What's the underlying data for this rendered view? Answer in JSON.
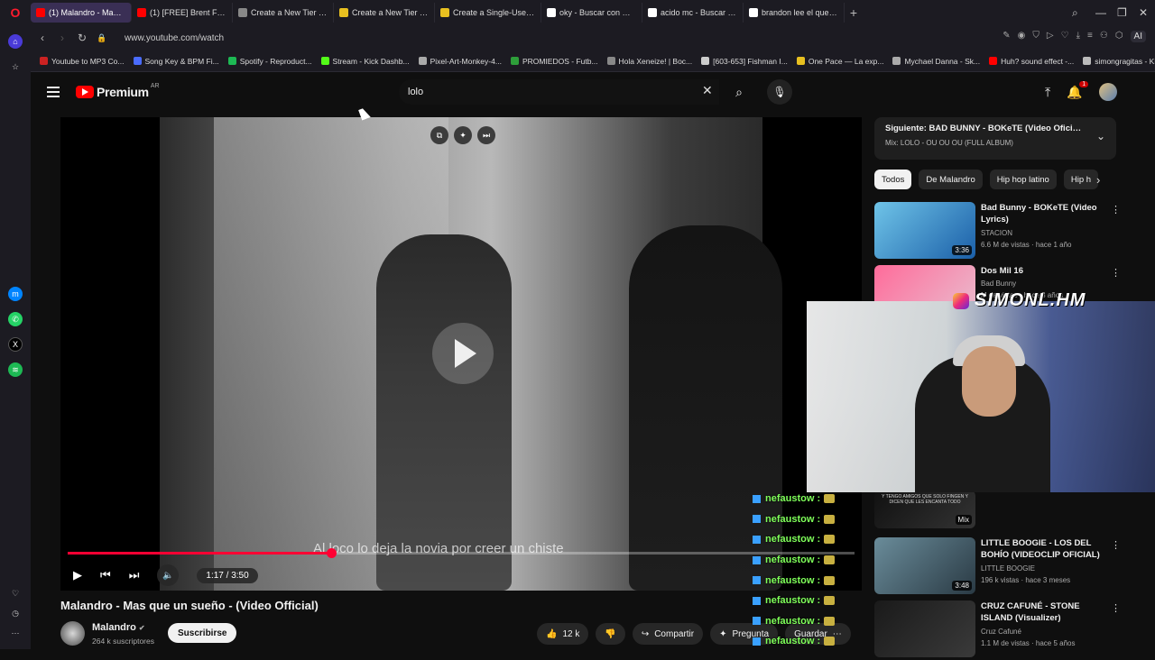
{
  "browser": {
    "tabs": [
      {
        "label": "(1) Malandro - Mas que u",
        "color": "#ff0000",
        "active": true
      },
      {
        "label": "(1) [FREE] Brent Faiyaz x S",
        "color": "#ff0000",
        "active": false
      },
      {
        "label": "Create a New Tier List - Ti",
        "color": "#888888",
        "active": false
      },
      {
        "label": "Create a New Tier List - Ti",
        "color": "#e8c020",
        "active": false
      },
      {
        "label": "Create a Single-Use Tier L",
        "color": "#e8c020",
        "active": false
      },
      {
        "label": "oky - Buscar con Google",
        "color": "#ffffff",
        "active": false
      },
      {
        "label": "acido mc - Buscar con Go",
        "color": "#ffffff",
        "active": false
      },
      {
        "label": "brandon lee el queschuga",
        "color": "#ffffff",
        "active": false
      }
    ],
    "url": "www.youtube.com/watch",
    "ai_label": "AI",
    "bookmarks": [
      {
        "label": "Youtube to MP3 Co...",
        "color": "#cc2222"
      },
      {
        "label": "Song Key & BPM Fi...",
        "color": "#4a6cff"
      },
      {
        "label": "Spotify - Reproduct...",
        "color": "#1db954"
      },
      {
        "label": "Stream - Kick Dashb...",
        "color": "#53fc18"
      },
      {
        "label": "Pixel-Art-Monkey-4...",
        "color": "#aaaaaa"
      },
      {
        "label": "PROMIEDOS - Futb...",
        "color": "#2e9e3a"
      },
      {
        "label": "Hola Xeneize! | Boc...",
        "color": "#888888"
      },
      {
        "label": "[603-653] Fishman I...",
        "color": "#cccccc"
      },
      {
        "label": "One Pace — La exp...",
        "color": "#e8c020"
      },
      {
        "label": "Mychael Danna - Sk...",
        "color": "#aaaaaa"
      },
      {
        "label": "Huh? sound effect -...",
        "color": "#ff0000"
      },
      {
        "label": "simongragitas - Kic...",
        "color": "#bbbbbb"
      }
    ]
  },
  "youtube": {
    "logo": "Premium",
    "region": "AR",
    "search_value": "lolo",
    "notification_count": "1",
    "video": {
      "title": "Malandro - Mas que un sueño - (Video Official)",
      "subtitle": "Al loco lo deja la novia por creer un chiste",
      "time": "1:17 / 3:50",
      "progress": 0.335
    },
    "channel": {
      "name": "Malandro",
      "subscribers": "264 k suscriptores",
      "subscribe_label": "Suscribirse"
    },
    "actions": {
      "likes": "12 k",
      "share": "Compartir",
      "ask": "Pregunta",
      "save": "Guardar"
    },
    "next": {
      "title": "Siguiente: BAD BUNNY - BOKeTE (Video Oficial) | D...",
      "mix": "Mix: LOLO - OU OU OU (FULL ALBUM)"
    },
    "chips": [
      "Todos",
      "De Malandro",
      "Hip hop latino",
      "Hip h"
    ],
    "recommendations": [
      {
        "title": "Bad Bunny - BOKeTE (Video Lyrics)",
        "channel": "STACION",
        "meta": "6.6 M de vistas · hace 1 año",
        "duration": "3:36"
      },
      {
        "title": "Dos Mil 16",
        "channel": "Bad Bunny",
        "meta": "M de vistas · hace 3 años",
        "duration": ""
      },
      {
        "title": "",
        "channel": "",
        "meta": "",
        "duration": "Mix",
        "thumb_text": "Y TENGO AMIGOS QUE SOLO FINGEN Y DICEN QUE LES ENCANTA TODO"
      },
      {
        "title": "LITTLE BOOGIE - LOS DEL BOHÍO (VIDEOCLIP OFICIAL)",
        "channel": "LITTLE BOOGIE",
        "meta": "196 k vistas · hace 3 meses",
        "duration": "3:48"
      },
      {
        "title": "CRUZ CAFUNÉ - STONE ISLAND (Visualizer)",
        "channel": "Cruz Cafuné",
        "meta": "1.1 M de vistas · hace 5 años",
        "duration": ""
      }
    ]
  },
  "chat": {
    "lines": [
      "nefaustow :",
      "nefaustow :",
      "nefaustow :",
      "nefaustow :",
      "nefaustow :",
      "nefaustow :",
      "nefaustow :",
      "nefaustow :"
    ]
  },
  "webcam": {
    "handle": "SIMONL.HM"
  }
}
